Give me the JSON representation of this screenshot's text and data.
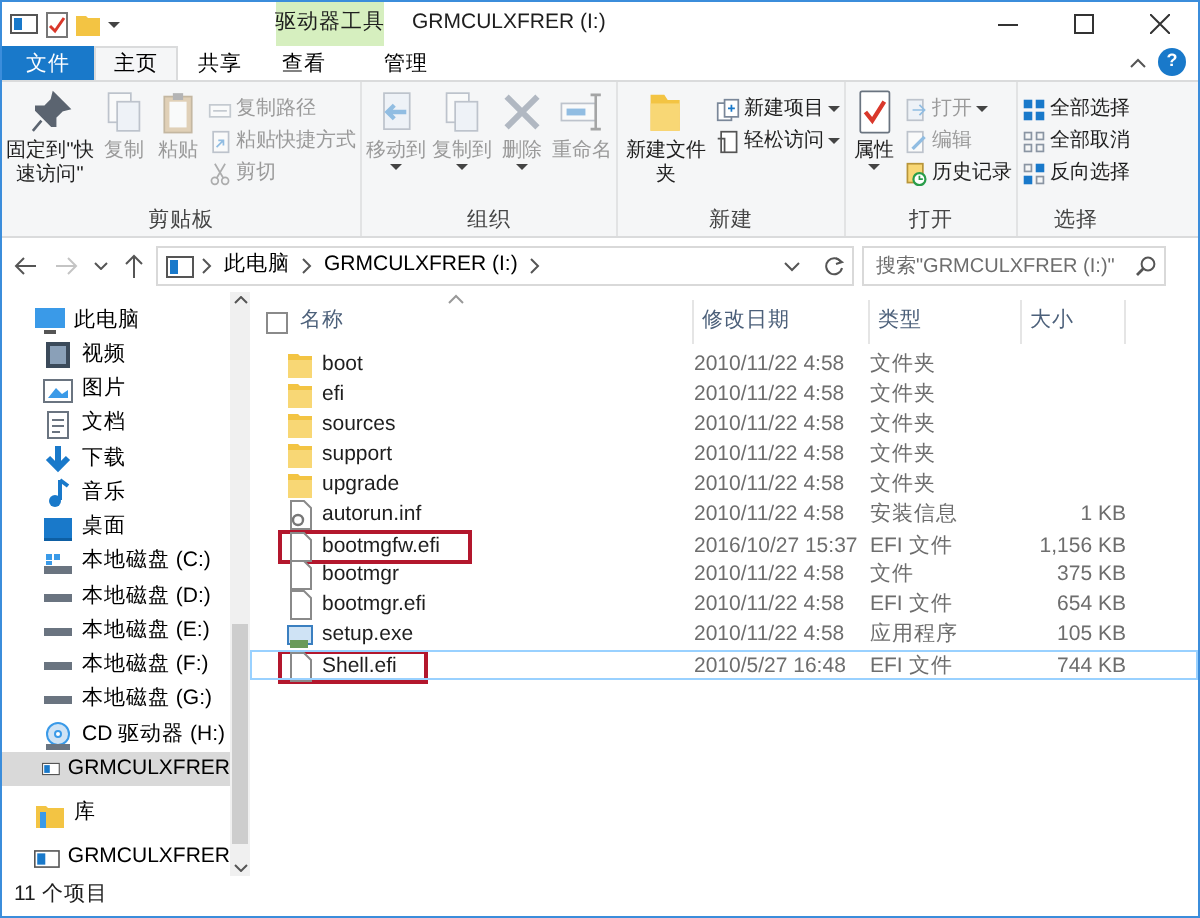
{
  "title_bar": {
    "context_tab": "驱动器工具",
    "title": "GRMCULXFRER (I:)"
  },
  "ribbon_tabs": [
    {
      "label": "文件",
      "kind": "file",
      "selected": false
    },
    {
      "label": "主页",
      "kind": "tab",
      "selected": true
    },
    {
      "label": "共享",
      "kind": "tab",
      "selected": false
    },
    {
      "label": "查看",
      "kind": "tab",
      "selected": false
    },
    {
      "label": "管理",
      "kind": "context",
      "selected": false
    }
  ],
  "help": "?",
  "ribbon_groups": [
    {
      "label": "剪贴板",
      "buttons": [
        {
          "label": "固定到\"快速访问\"",
          "kind": "large",
          "disabled": false,
          "dropdown": false
        },
        {
          "label": "复制",
          "kind": "large",
          "disabled": true,
          "dropdown": false
        },
        {
          "label": "粘贴",
          "kind": "large",
          "disabled": true,
          "dropdown": false
        },
        {
          "label": "复制路径",
          "kind": "small",
          "disabled": true,
          "dropdown": false
        },
        {
          "label": "粘贴快捷方式",
          "kind": "small",
          "disabled": true,
          "dropdown": false
        },
        {
          "label": "剪切",
          "kind": "small",
          "disabled": true,
          "dropdown": false
        }
      ]
    },
    {
      "label": "组织",
      "buttons": [
        {
          "label": "移动到",
          "kind": "large",
          "disabled": true,
          "dropdown": true
        },
        {
          "label": "复制到",
          "kind": "large",
          "disabled": true,
          "dropdown": true
        },
        {
          "label": "删除",
          "kind": "large",
          "disabled": true,
          "dropdown": true
        },
        {
          "label": "重命名",
          "kind": "large",
          "disabled": true,
          "dropdown": false
        }
      ]
    },
    {
      "label": "新建",
      "buttons": [
        {
          "label": "新建文件夹",
          "kind": "large",
          "disabled": false,
          "dropdown": false
        },
        {
          "label": "新建项目",
          "kind": "small",
          "disabled": false,
          "dropdown": true
        },
        {
          "label": "轻松访问",
          "kind": "small",
          "disabled": false,
          "dropdown": true
        }
      ]
    },
    {
      "label": "打开",
      "buttons": [
        {
          "label": "属性",
          "kind": "large",
          "disabled": false,
          "dropdown": true
        },
        {
          "label": "打开",
          "kind": "small",
          "disabled": true,
          "dropdown": true
        },
        {
          "label": "编辑",
          "kind": "small",
          "disabled": true,
          "dropdown": false
        },
        {
          "label": "历史记录",
          "kind": "small",
          "disabled": false,
          "dropdown": false
        }
      ]
    },
    {
      "label": "选择",
      "buttons": [
        {
          "label": "全部选择",
          "kind": "small",
          "disabled": false,
          "dropdown": false
        },
        {
          "label": "全部取消",
          "kind": "small",
          "disabled": false,
          "dropdown": false
        },
        {
          "label": "反向选择",
          "kind": "small",
          "disabled": false,
          "dropdown": false
        }
      ]
    }
  ],
  "address_bar": {
    "path": [
      "此电脑",
      "GRMCULXFRER (I:)"
    ],
    "forward_disabled": true
  },
  "search": {
    "placeholder": "搜索\"GRMCULXFRER (I:)\""
  },
  "navigation": [
    {
      "label": "此电脑",
      "kind": "pc",
      "selected": false,
      "children": [
        {
          "label": "视频",
          "kind": "video",
          "selected": false
        },
        {
          "label": "图片",
          "kind": "pictures",
          "selected": false
        },
        {
          "label": "文档",
          "kind": "documents",
          "selected": false
        },
        {
          "label": "下载",
          "kind": "download",
          "selected": false
        },
        {
          "label": "音乐",
          "kind": "music",
          "selected": false
        },
        {
          "label": "桌面",
          "kind": "desktop",
          "selected": false
        },
        {
          "label": "本地磁盘 (C:)",
          "kind": "system_disk",
          "selected": false
        },
        {
          "label": "本地磁盘 (D:)",
          "kind": "disk",
          "selected": false
        },
        {
          "label": "本地磁盘 (E:)",
          "kind": "disk",
          "selected": false
        },
        {
          "label": "本地磁盘 (F:)",
          "kind": "disk",
          "selected": false
        },
        {
          "label": "本地磁盘 (G:)",
          "kind": "disk",
          "selected": false
        },
        {
          "label": "CD 驱动器 (H:)",
          "kind": "cd",
          "selected": false
        },
        {
          "label": "GRMCULXFRER",
          "kind": "drive",
          "selected": true
        }
      ]
    },
    {
      "label": "库",
      "kind": "library",
      "selected": false
    },
    {
      "label": "GRMCULXFRER",
      "kind": "drive",
      "selected": false
    }
  ],
  "columns": [
    "名称",
    "修改日期",
    "类型",
    "大小"
  ],
  "select_all_checked": false,
  "files": [
    {
      "name": "boot",
      "date": "2010/11/22 4:58",
      "type": "文件夹",
      "kind": "folder",
      "highlighted": false,
      "focused": false
    },
    {
      "name": "efi",
      "date": "2010/11/22 4:58",
      "type": "文件夹",
      "kind": "folder",
      "highlighted": false,
      "focused": false
    },
    {
      "name": "sources",
      "date": "2010/11/22 4:58",
      "type": "文件夹",
      "kind": "folder",
      "highlighted": false,
      "focused": false
    },
    {
      "name": "support",
      "date": "2010/11/22 4:58",
      "type": "文件夹",
      "kind": "folder",
      "highlighted": false,
      "focused": false
    },
    {
      "name": "upgrade",
      "date": "2010/11/22 4:58",
      "type": "文件夹",
      "kind": "folder",
      "highlighted": false,
      "focused": false
    },
    {
      "name": "autorun.inf",
      "date": "2010/11/22 4:58",
      "type": "安装信息",
      "size": "1 KB",
      "kind": "setup_info",
      "highlighted": false,
      "focused": false
    },
    {
      "name": "bootmgfw.efi",
      "date": "2016/10/27 15:37",
      "type": "EFI 文件",
      "size": "1,156 KB",
      "kind": "file",
      "highlighted": true,
      "focused": false
    },
    {
      "name": "bootmgr",
      "date": "2010/11/22 4:58",
      "type": "文件",
      "size": "375 KB",
      "kind": "file",
      "highlighted": false,
      "focused": false
    },
    {
      "name": "bootmgr.efi",
      "date": "2010/11/22 4:58",
      "type": "EFI 文件",
      "size": "654 KB",
      "kind": "file",
      "highlighted": false,
      "focused": false
    },
    {
      "name": "setup.exe",
      "date": "2010/11/22 4:58",
      "type": "应用程序",
      "size": "105 KB",
      "kind": "program",
      "highlighted": false,
      "focused": false
    },
    {
      "name": "Shell.efi",
      "date": "2010/5/27 16:48",
      "type": "EFI 文件",
      "size": "744 KB",
      "kind": "file",
      "highlighted": true,
      "focused": true
    }
  ],
  "status_bar": "11 个项目"
}
